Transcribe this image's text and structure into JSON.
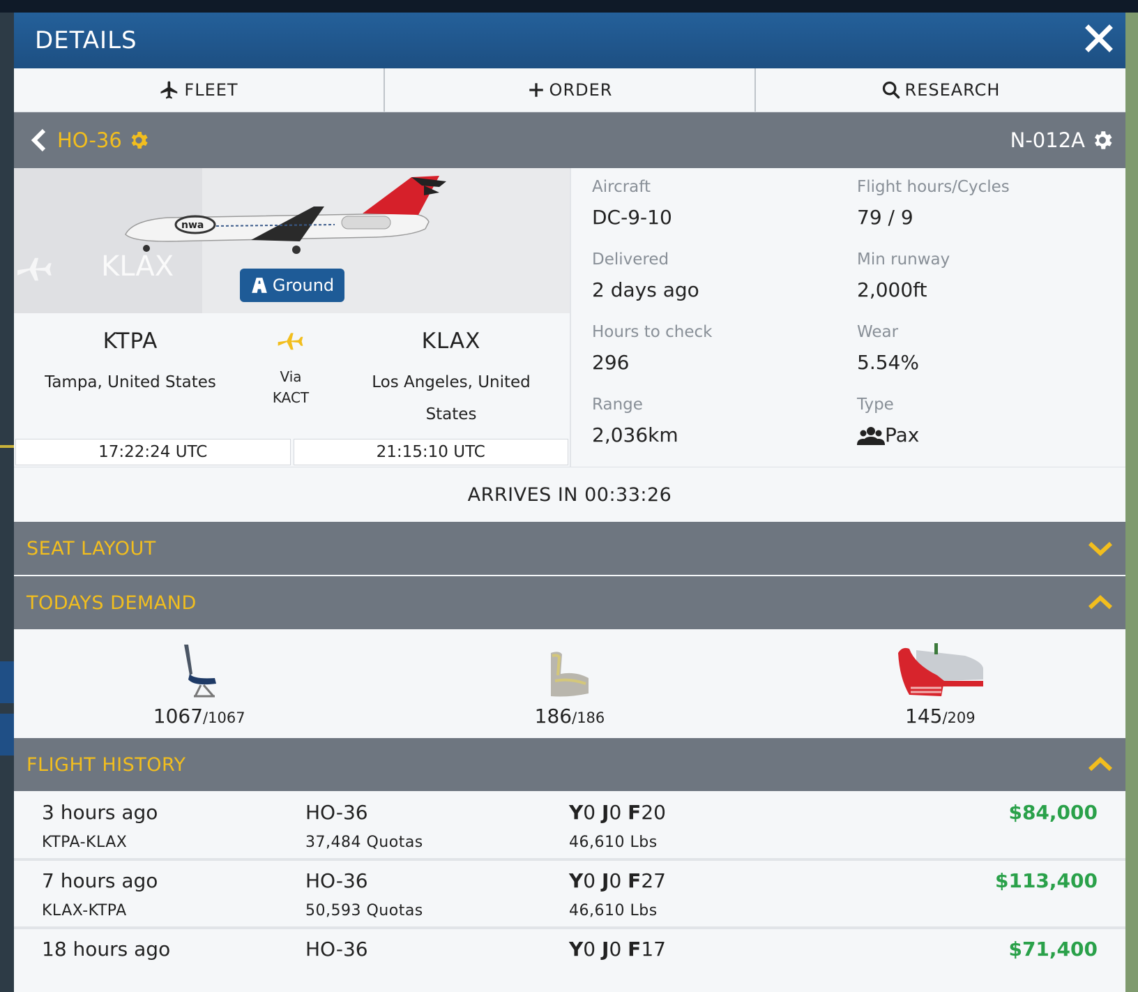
{
  "modal": {
    "title": "DETAILS"
  },
  "tabs": [
    {
      "label": "FLEET"
    },
    {
      "label": "ORDER"
    },
    {
      "label": "RESEARCH"
    }
  ],
  "aircraft_bar": {
    "route_name": "HO-36",
    "registration": "N-012A"
  },
  "photo": {
    "status": "Ground",
    "ghost_label": "KLAX"
  },
  "route": {
    "origin": {
      "code": "KTPA",
      "city": "Tampa, United States",
      "time": "17:22:24 UTC"
    },
    "via_label": "Via",
    "via_code": "KACT",
    "destination": {
      "code": "KLAX",
      "city": "Los Angeles, United States",
      "time": "21:15:10 UTC"
    }
  },
  "details": {
    "aircraft": {
      "label": "Aircraft",
      "value": "DC-9-10"
    },
    "flight_hours": {
      "label": "Flight hours/Cycles",
      "value": "79 / 9"
    },
    "delivered": {
      "label": "Delivered",
      "value": "2 days ago"
    },
    "min_runway": {
      "label": "Min runway",
      "value": "2,000ft"
    },
    "hours_to_check": {
      "label": "Hours to check",
      "value": "296"
    },
    "wear": {
      "label": "Wear",
      "value": "5.54%"
    },
    "range": {
      "label": "Range",
      "value": "2,036km"
    },
    "type": {
      "label": "Type",
      "value": "Pax"
    }
  },
  "arrives": "ARRIVES IN 00:33:26",
  "sections": {
    "seat_layout": "SEAT LAYOUT",
    "todays_demand": "TODAYS DEMAND",
    "flight_history": "FLIGHT HISTORY"
  },
  "demand": [
    {
      "icon": "economy-seat-icon",
      "value": "1067",
      "total": "/1067"
    },
    {
      "icon": "business-seat-icon",
      "value": "186",
      "total": "/186"
    },
    {
      "icon": "first-class-seat-icon",
      "value": "145",
      "total": "/209"
    }
  ],
  "history": [
    {
      "when": "3 hours ago",
      "route": "KTPA-KLAX",
      "flight": "HO-36",
      "quotas": "37,484 Quotas",
      "y": "0",
      "j": "0",
      "f": "20",
      "cargo": "46,610 Lbs",
      "income": "$84,000"
    },
    {
      "when": "7 hours ago",
      "route": "KLAX-KTPA",
      "flight": "HO-36",
      "quotas": "50,593 Quotas",
      "y": "0",
      "j": "0",
      "f": "27",
      "cargo": "46,610 Lbs",
      "income": "$113,400"
    },
    {
      "when": "18 hours ago",
      "route": "",
      "flight": "HO-36",
      "quotas": "",
      "y": "0",
      "j": "0",
      "f": "17",
      "cargo": "",
      "income": "$71,400"
    }
  ],
  "class_letters": {
    "y": "Y",
    "j": "J",
    "f": "F"
  },
  "colors": {
    "header": "#1d4f82",
    "accent": "#f2be1e",
    "bar": "#6e7680",
    "income": "#2aa14a"
  }
}
